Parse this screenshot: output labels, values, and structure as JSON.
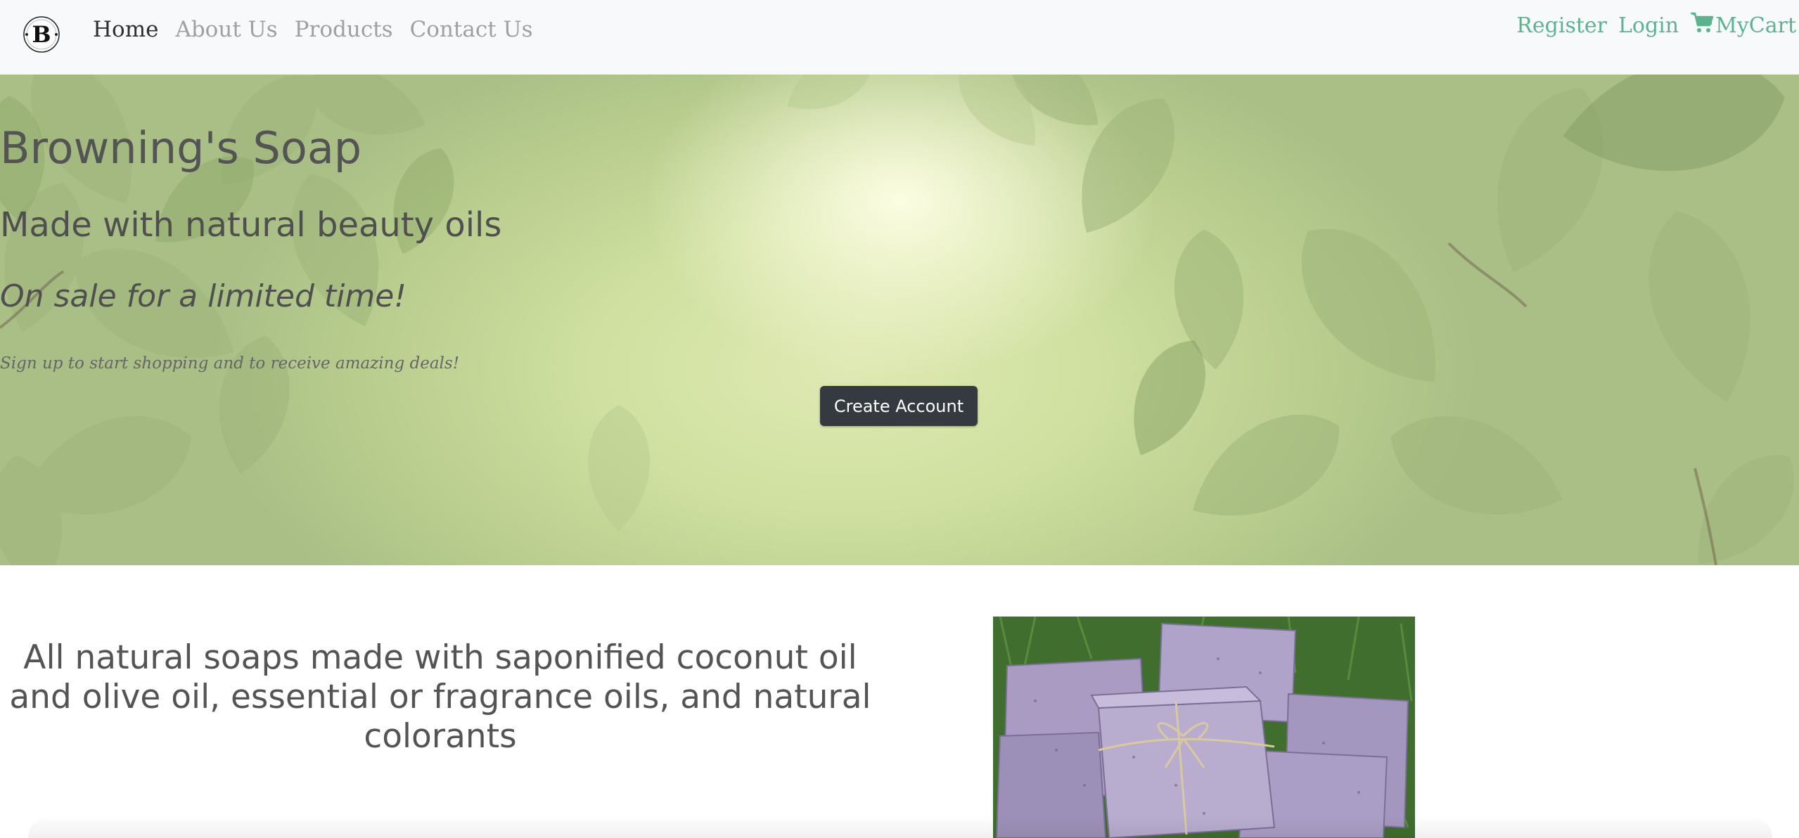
{
  "navbar": {
    "brand_letter": "B",
    "links": [
      {
        "label": "Home",
        "active": true
      },
      {
        "label": "About Us",
        "active": false
      },
      {
        "label": "Products",
        "active": false
      },
      {
        "label": "Contact Us",
        "active": false
      }
    ],
    "register_label": "Register",
    "login_label": "Login",
    "cart_label": "MyCart",
    "cart_icon": "shopping-cart-icon",
    "link_color": "#5bb38f"
  },
  "hero": {
    "title": "Browning's Soap",
    "subtitle": "Made with natural beauty oils",
    "sale_text": "On sale for a limited time!",
    "signup_text": "Sign up to start shopping and to receive amazing deals!",
    "create_account_label": "Create Account",
    "button_color": "#343a40"
  },
  "feature": {
    "description": "All natural soaps made with saponified coconut oil and olive oil, essential or fragrance oils, and natural colorants"
  }
}
